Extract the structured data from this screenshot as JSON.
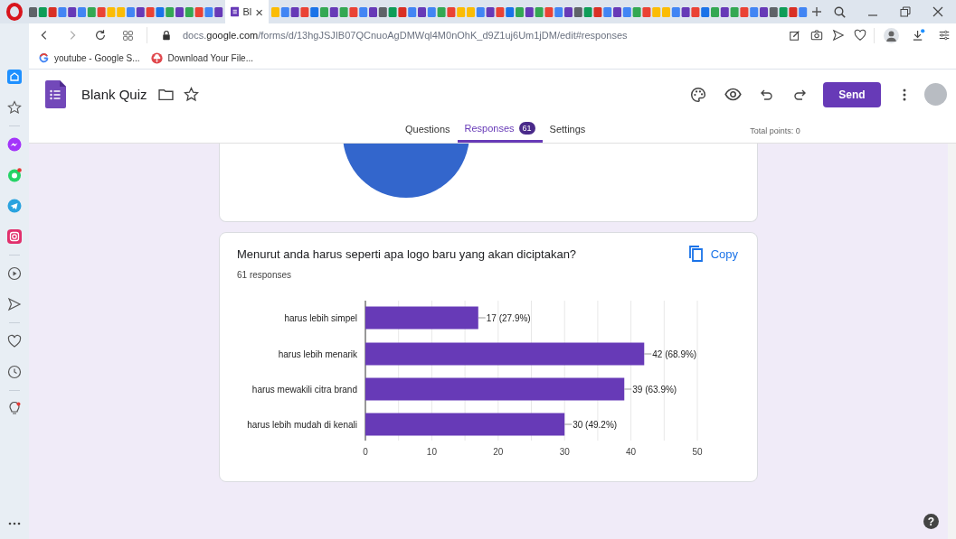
{
  "browser": {
    "active_tab": {
      "title": "Bl",
      "close": "×"
    },
    "url": [
      {
        "text": "docs.",
        "emphasis": false
      },
      {
        "text": "google.com",
        "emphasis": true
      },
      {
        "text": "/forms/d/13hgJSJIB07QCnuoAgDMWql4M0nOhK_d9Z1uj6Um1jDM/edit#responses",
        "emphasis": false
      }
    ],
    "bookmarks": [
      {
        "label": "youtube - Google S...",
        "kind": "google"
      },
      {
        "label": "Download Your File...",
        "kind": "download"
      }
    ]
  },
  "form": {
    "title": "Blank Quiz",
    "send_button": "Send",
    "tabs": [
      {
        "label": "Questions",
        "selected": false
      },
      {
        "label": "Responses",
        "badge": "61",
        "selected": true
      },
      {
        "label": "Settings",
        "selected": false
      }
    ],
    "total_points": "Total points: 0"
  },
  "question": {
    "title": "Menurut anda harus seperti apa logo baru yang akan diciptakan?",
    "copy_button": "Copy",
    "response_count": "61 responses",
    "chart_data": {
      "type": "bar",
      "orientation": "horizontal",
      "categories": [
        "harus lebih simpel",
        "harus lebih menarik",
        "harus mewakili citra brand",
        "harus lebih mudah di kenali"
      ],
      "series": [
        {
          "color": "#673ab7",
          "values": [
            17,
            42,
            39,
            30
          ]
        }
      ],
      "xlim": [
        0,
        50
      ],
      "grid": true,
      "xticks": [
        0,
        10,
        20,
        30,
        40,
        50
      ],
      "value_labels": [
        "17 (27.9%)",
        "42 (68.9%)",
        "39 (63.9%)",
        "30 (49.2%)"
      ]
    }
  },
  "help_button": "?"
}
